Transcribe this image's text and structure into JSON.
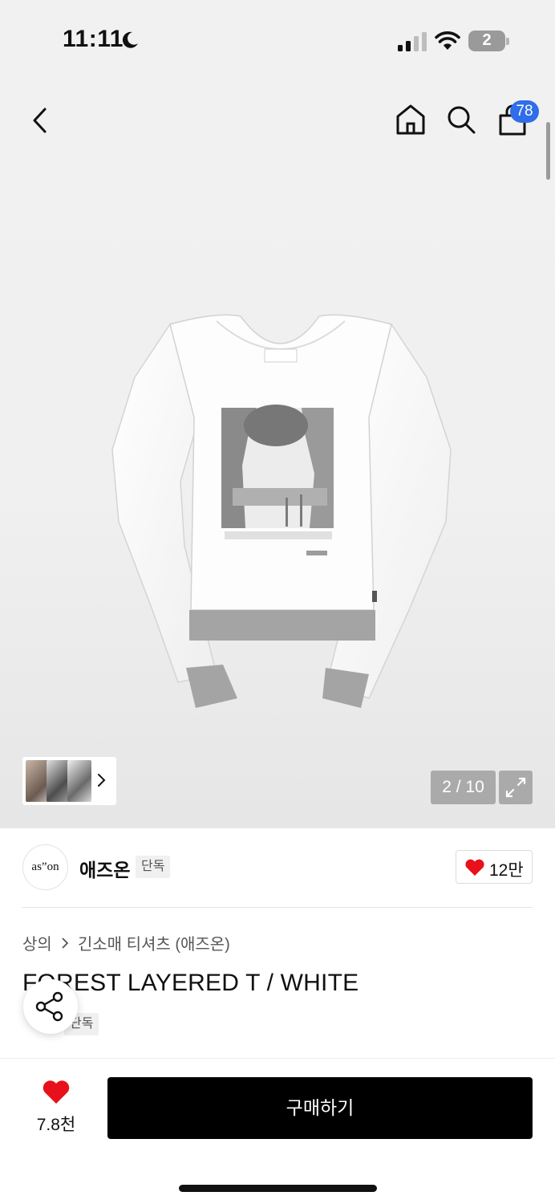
{
  "status_bar": {
    "time": "11:11",
    "battery_level": "2"
  },
  "nav": {
    "cart_count": "78"
  },
  "gallery": {
    "page_counter": "2 / 10",
    "current_index": 2,
    "total": 10
  },
  "brand": {
    "logo_text": "as”on",
    "name": "애즈온",
    "tag": "단독",
    "like_count": "12만"
  },
  "breadcrumb": {
    "category": "상의",
    "subcategory": "긴소매 티셔츠 (애즈온)"
  },
  "product": {
    "title": "FOREST LAYERED T / WHITE",
    "tag": "단독"
  },
  "bottom_bar": {
    "wish_count": "7.8천",
    "buy_label": "구매하기"
  },
  "colors": {
    "accent_blue": "#2f6dea",
    "heart_red": "#e8101a",
    "buy_button": "#000000"
  }
}
